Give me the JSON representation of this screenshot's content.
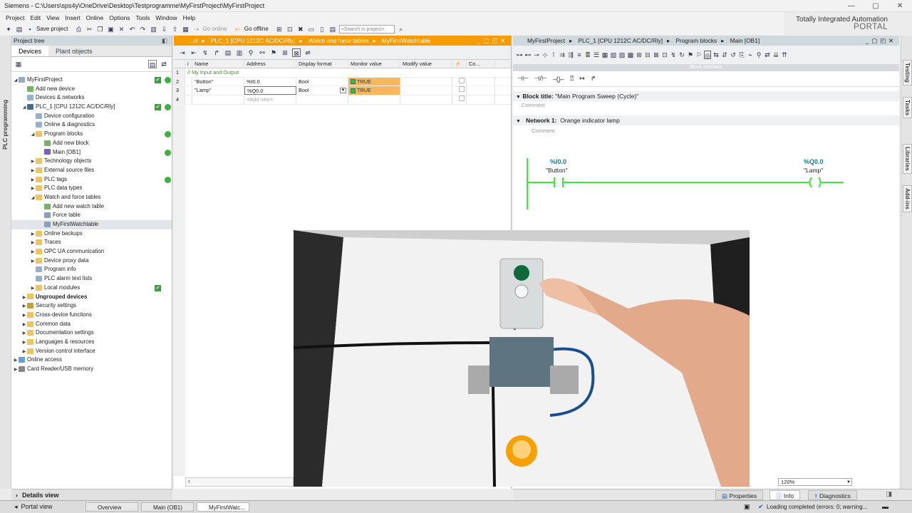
{
  "app": {
    "title": "Siemens  -  C:\\Users\\sps4y\\OneDrive\\Desktop\\Testprogramme\\MyFirstProject\\MyFirstProject",
    "brand_line1": "Totally Integrated Automation",
    "brand_line2": "PORTAL"
  },
  "menu": [
    "Project",
    "Edit",
    "View",
    "Insert",
    "Online",
    "Options",
    "Tools",
    "Window",
    "Help"
  ],
  "toolbar": {
    "save_label": "Save project",
    "go_online": "Go online",
    "go_offline": "Go offline",
    "search_placeholder": "<Search in project>"
  },
  "left_strip": "PLC programming",
  "project_tree": {
    "title": "Project tree",
    "tabs": [
      "Devices",
      "Plant objects"
    ],
    "items": [
      {
        "label": "MyFirstProject",
        "indent": 0,
        "expand": "open",
        "icon": "project-icon",
        "check": true,
        "dot": true
      },
      {
        "label": "Add new device",
        "indent": 1,
        "expand": "",
        "icon": "add-device-icon"
      },
      {
        "label": "Devices & networks",
        "indent": 1,
        "expand": "",
        "icon": "network-icon"
      },
      {
        "label": "PLC_1 [CPU 1212C AC/DC/Rly]",
        "indent": 1,
        "expand": "open",
        "icon": "plc-icon",
        "check": true,
        "dot": true
      },
      {
        "label": "Device configuration",
        "indent": 2,
        "expand": "",
        "icon": "config-icon"
      },
      {
        "label": "Online & diagnostics",
        "indent": 2,
        "expand": "",
        "icon": "diagnostics-icon"
      },
      {
        "label": "Program blocks",
        "indent": 2,
        "expand": "open",
        "icon": "folder-icon",
        "dot": true
      },
      {
        "label": "Add new block",
        "indent": 3,
        "expand": "",
        "icon": "add-block-icon"
      },
      {
        "label": "Main [OB1]",
        "indent": 3,
        "expand": "",
        "icon": "ob-icon",
        "dot": true
      },
      {
        "label": "Technology objects",
        "indent": 2,
        "expand": "closed",
        "icon": "folder-icon"
      },
      {
        "label": "External source files",
        "indent": 2,
        "expand": "closed",
        "icon": "folder-icon"
      },
      {
        "label": "PLC tags",
        "indent": 2,
        "expand": "closed",
        "icon": "folder-icon",
        "dot": true
      },
      {
        "label": "PLC data types",
        "indent": 2,
        "expand": "closed",
        "icon": "folder-icon"
      },
      {
        "label": "Watch and force tables",
        "indent": 2,
        "expand": "open",
        "icon": "folder-icon"
      },
      {
        "label": "Add new watch table",
        "indent": 3,
        "expand": "",
        "icon": "add-table-icon"
      },
      {
        "label": "Force table",
        "indent": 3,
        "expand": "",
        "icon": "table-icon"
      },
      {
        "label": "MyFirstWatchtable",
        "indent": 3,
        "expand": "",
        "icon": "table-icon",
        "selected": true
      },
      {
        "label": "Online backups",
        "indent": 2,
        "expand": "closed",
        "icon": "folder-icon"
      },
      {
        "label": "Traces",
        "indent": 2,
        "expand": "closed",
        "icon": "folder-icon"
      },
      {
        "label": "OPC UA communication",
        "indent": 2,
        "expand": "closed",
        "icon": "folder-icon"
      },
      {
        "label": "Device proxy data",
        "indent": 2,
        "expand": "closed",
        "icon": "folder-icon"
      },
      {
        "label": "Program info",
        "indent": 2,
        "expand": "",
        "icon": "info-icon"
      },
      {
        "label": "PLC alarm text lists",
        "indent": 2,
        "expand": "",
        "icon": "list-icon"
      },
      {
        "label": "Local modules",
        "indent": 2,
        "expand": "closed",
        "icon": "folder-icon",
        "check": true
      },
      {
        "label": "Ungrouped devices",
        "indent": 1,
        "expand": "closed",
        "icon": "folder-icon",
        "bold": true
      },
      {
        "label": "Security settings",
        "indent": 1,
        "expand": "closed",
        "icon": "security-icon"
      },
      {
        "label": "Cross-device functions",
        "indent": 1,
        "expand": "closed",
        "icon": "folder-icon"
      },
      {
        "label": "Common data",
        "indent": 1,
        "expand": "closed",
        "icon": "folder-icon"
      },
      {
        "label": "Documentation settings",
        "indent": 1,
        "expand": "closed",
        "icon": "folder-icon"
      },
      {
        "label": "Languages & resources",
        "indent": 1,
        "expand": "closed",
        "icon": "folder-icon"
      },
      {
        "label": "Version control interface",
        "indent": 1,
        "expand": "closed",
        "icon": "folder-icon"
      },
      {
        "label": "Online access",
        "indent": 0,
        "expand": "closed",
        "icon": "online-icon"
      },
      {
        "label": "Card Reader/USB memory",
        "indent": 0,
        "expand": "closed",
        "icon": "card-icon"
      }
    ],
    "details": "Details view"
  },
  "watch": {
    "breadcrumb": [
      "...ct",
      "PLC_1 [CPU 1212C AC/DC/Rly]",
      "Watch and force tables",
      "MyFirstWatchtable"
    ],
    "headers": [
      "i",
      "Name",
      "Address",
      "Display format",
      "Monitor value",
      "Modify value",
      "",
      "Co..."
    ],
    "comment_row": "// My Input and Output",
    "rows": [
      {
        "num": "1",
        "comment": true
      },
      {
        "num": "2",
        "name": "\"Button\"",
        "address": "%I0.0",
        "format": "Bool",
        "monitor": "TRUE"
      },
      {
        "num": "3",
        "name": "\"Lamp\"",
        "address": "%Q0.0",
        "format": "Bool",
        "monitor": "TRUE"
      },
      {
        "num": "4",
        "add": "<Add new>"
      }
    ]
  },
  "editor": {
    "breadcrumb": [
      "MyFirstProject",
      "PLC_1 [CPU 1212C AC/DC/Rly]",
      "Program blocks",
      "Main [OB1]"
    ],
    "block_interface": "Block interface",
    "block_title_label": "Block title:",
    "block_title": "\"Main Program Sweep (Cycle)\"",
    "comment": "Comment",
    "network_label": "Network 1:",
    "network_title": "Orange indicator lamp",
    "contact_addr": "%I0.0",
    "contact_tag": "\"Button\"",
    "coil_addr": "%Q0.0",
    "coil_tag": "\"Lamp\"",
    "zoom": "120%"
  },
  "right_tabs": [
    "Testing",
    "Tasks",
    "Libraries",
    "Add-ins"
  ],
  "info_tabs": [
    "Properties",
    "Info",
    "Diagnostics"
  ],
  "taskbar": {
    "portal": "Portal view",
    "items": [
      "Overview",
      "Main (OB1)",
      "MyFirstWatc..."
    ],
    "status": "Loading completed (errors: 0; warning..."
  },
  "colors": {
    "accent": "#f59c00",
    "ladder": "#3ee63e",
    "monitor_true": "#f7b75a"
  }
}
